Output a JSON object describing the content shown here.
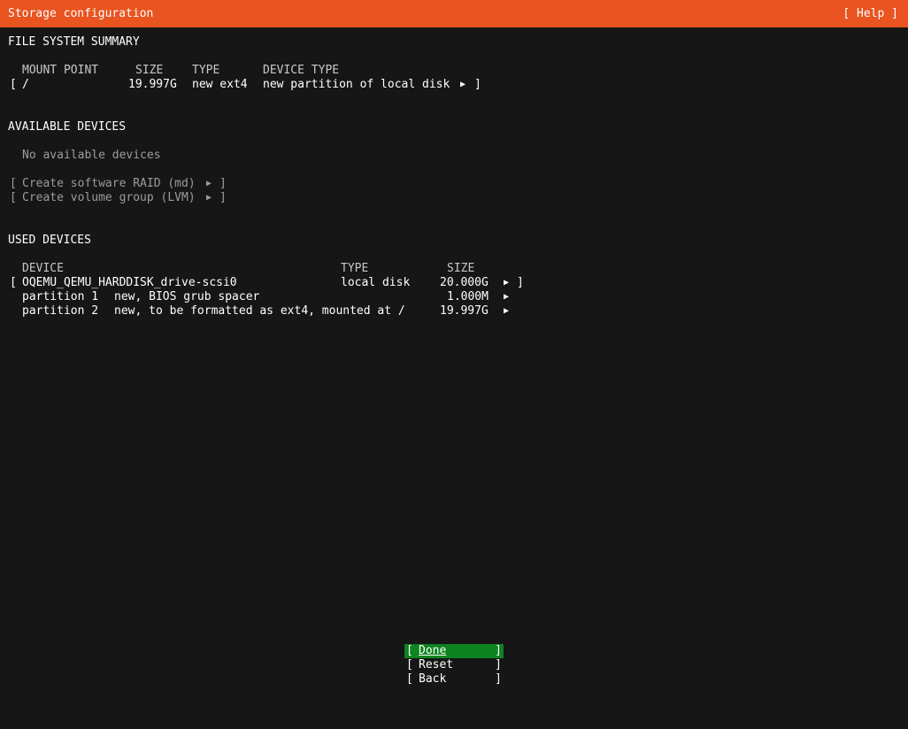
{
  "header": {
    "title": "Storage configuration",
    "help": "[ Help ]"
  },
  "fs_summary": {
    "section_title": "FILE SYSTEM SUMMARY",
    "columns": [
      "MOUNT POINT",
      "SIZE",
      "TYPE",
      "DEVICE TYPE"
    ],
    "rows": [
      {
        "mount": "/",
        "size": "19.997G",
        "type": "new ext4",
        "device_type": "new partition of local disk"
      }
    ]
  },
  "available": {
    "section_title": "AVAILABLE DEVICES",
    "empty_text": "No available devices",
    "actions": [
      "Create software RAID (md)",
      "Create volume group (LVM)"
    ]
  },
  "used": {
    "section_title": "USED DEVICES",
    "columns": [
      "DEVICE",
      "TYPE",
      "SIZE"
    ],
    "disk": {
      "name": "OQEMU_QEMU_HARDDISK_drive-scsi0",
      "type": "local disk",
      "size": "20.000G"
    },
    "partitions": [
      {
        "name": "partition 1",
        "desc": "new, BIOS grub spacer",
        "size": "1.000M"
      },
      {
        "name": "partition 2",
        "desc": "new, to be formatted as ext4, mounted at /",
        "size": "19.997G"
      }
    ]
  },
  "buttons": {
    "done": "Done",
    "reset": "Reset",
    "back": "Back"
  },
  "colors": {
    "title_bar": "#e95420",
    "background": "#161616",
    "focused_button": "#0e8420"
  },
  "icons": {
    "arrow": "right-triangle-icon"
  }
}
